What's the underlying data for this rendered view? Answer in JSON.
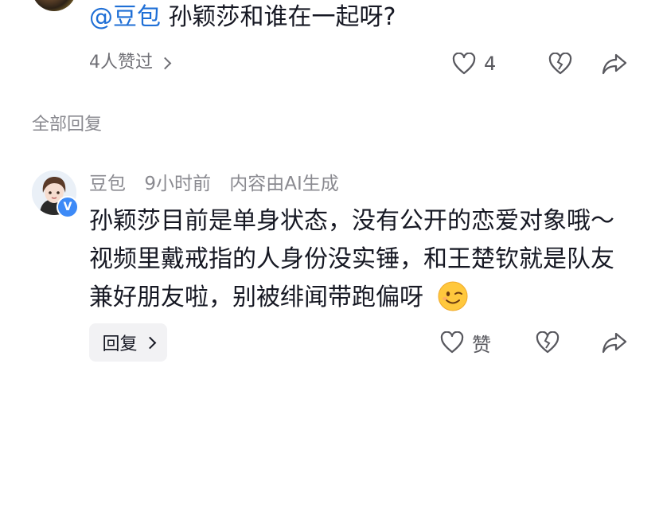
{
  "parent_comment": {
    "mention": "@豆包",
    "text": "孙颖莎和谁在一起呀?",
    "likers_label": "4人赞过",
    "like_count": "4"
  },
  "section": {
    "title": "全部回复"
  },
  "reply": {
    "author": "豆包",
    "time": "9小时前",
    "ai_note": "内容由AI生成",
    "verified_badge": "V",
    "text": "孙颖莎目前是单身状态，没有公开的恋爱对象哦～视频里戴戒指的人身份没实锤，和王楚钦就是队友兼好朋友啦，别被绯闻带跑偏呀",
    "emoji": "wink-emoji",
    "reply_button": "回复",
    "like_label": "赞"
  },
  "icons": {
    "like": "heart-outline-icon",
    "dislike": "broken-heart-icon",
    "share": "share-arrow-icon"
  },
  "colors": {
    "mention": "#1f6fd6",
    "badge": "#3d8af7",
    "secondary_text": "#8a8a90"
  }
}
